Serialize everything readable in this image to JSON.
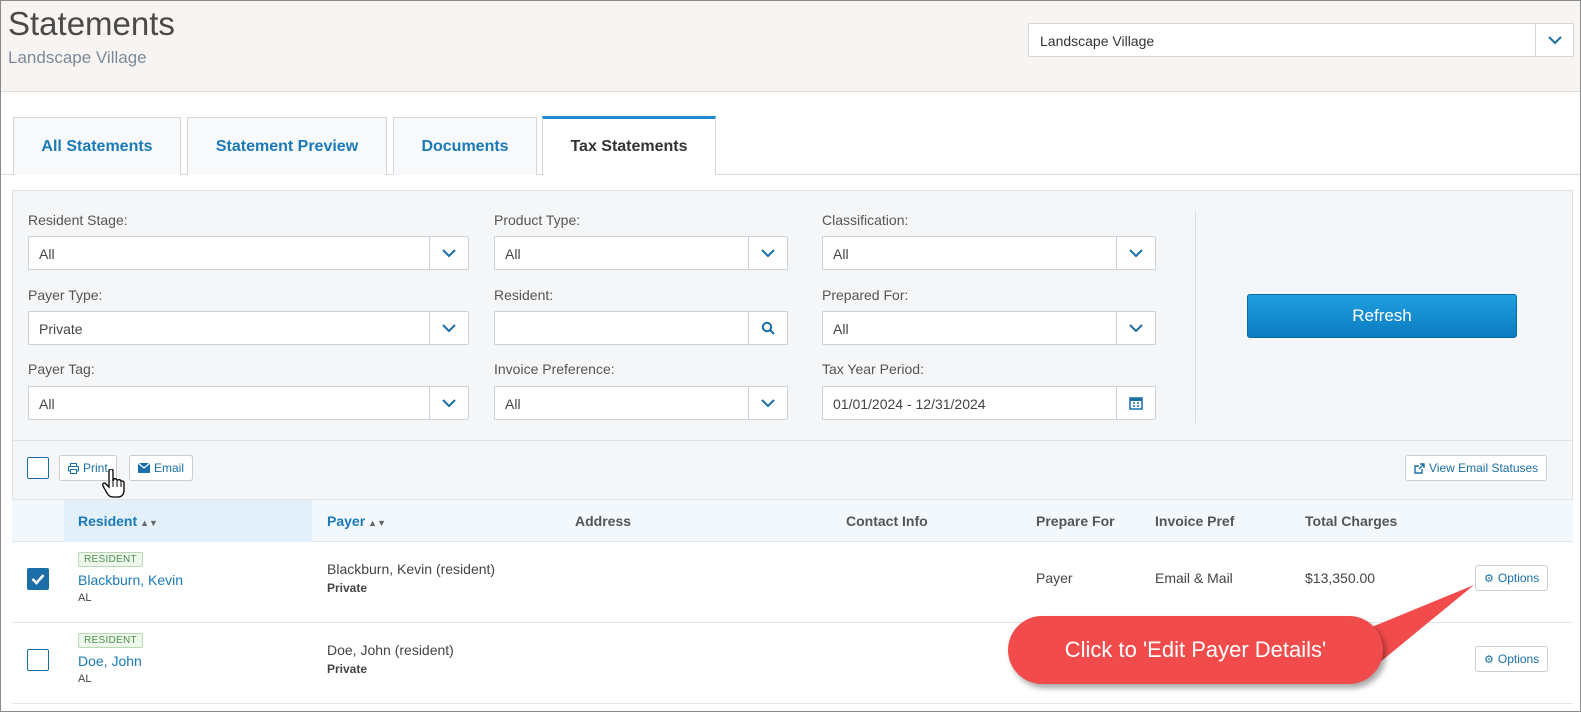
{
  "header": {
    "title": "Statements",
    "subtitle": "Landscape Village",
    "community_select": "Landscape Village"
  },
  "tabs": [
    {
      "label": "All Statements"
    },
    {
      "label": "Statement Preview"
    },
    {
      "label": "Documents"
    },
    {
      "label": "Tax Statements"
    }
  ],
  "filters": {
    "resident_stage": {
      "label": "Resident Stage:",
      "value": "All"
    },
    "product_type": {
      "label": "Product Type:",
      "value": "All"
    },
    "classification": {
      "label": "Classification:",
      "value": "All"
    },
    "payer_type": {
      "label": "Payer Type:",
      "value": "Private"
    },
    "resident": {
      "label": "Resident:",
      "value": ""
    },
    "prepared_for": {
      "label": "Prepared For:",
      "value": "All"
    },
    "payer_tag": {
      "label": "Payer Tag:",
      "value": "All"
    },
    "invoice_preference": {
      "label": "Invoice Preference:",
      "value": "All"
    },
    "tax_year_period": {
      "label": "Tax Year Period:",
      "value": "01/01/2024 - 12/31/2024"
    },
    "refresh_label": "Refresh"
  },
  "toolbar": {
    "print_label": "Print",
    "email_label": "Email",
    "view_email_statuses_label": "View Email Statuses"
  },
  "table": {
    "columns": [
      "Resident",
      "Payer",
      "Address",
      "Contact Info",
      "Prepare For",
      "Invoice Pref",
      "Total Charges"
    ],
    "rows": [
      {
        "checked": true,
        "badge": "RESIDENT",
        "name": "Blackburn, Kevin",
        "state": "AL",
        "payer": "Blackburn, Kevin (resident)",
        "payer_type": "Private",
        "address": "",
        "contact": "",
        "prepare_for": "Payer",
        "invoice_pref": "Email & Mail",
        "total": "$13,350.00",
        "options_label": "Options"
      },
      {
        "checked": false,
        "badge": "RESIDENT",
        "name": "Doe, John",
        "state": "AL",
        "payer": "Doe, John (resident)",
        "payer_type": "Private",
        "address": "",
        "contact": "",
        "prepare_for": "",
        "invoice_pref": "",
        "total": "",
        "options_label": "Options"
      }
    ]
  },
  "callout": {
    "text": "Click to 'Edit Payer Details'",
    "color": "#f24b4b"
  },
  "colors": {
    "accent": "#1a7ab8",
    "refresh_button": "#1290d4",
    "header_bg": "#f8f4f2"
  }
}
